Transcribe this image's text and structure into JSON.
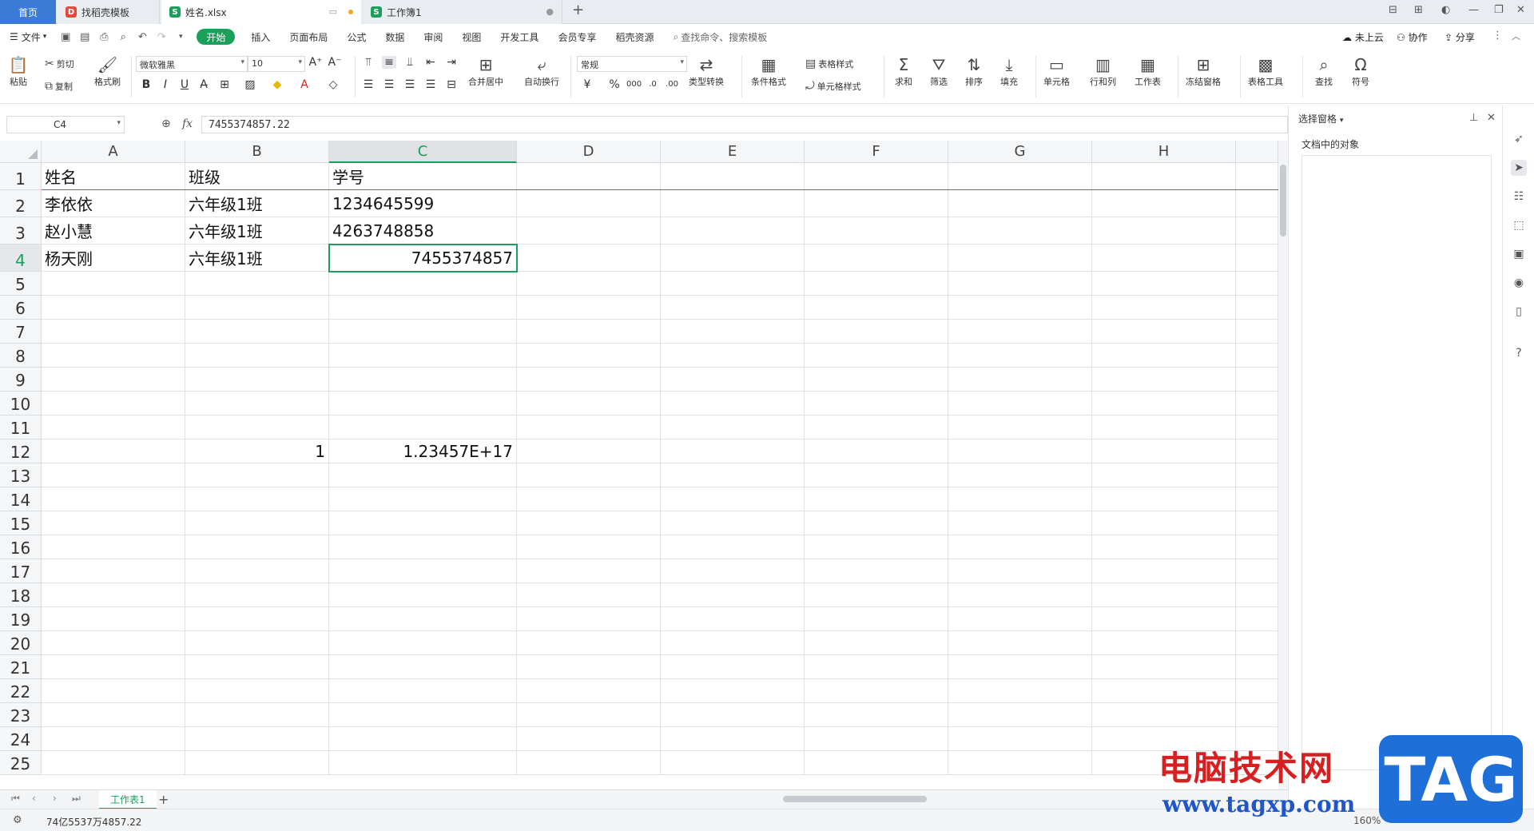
{
  "tabs": {
    "home": "首页",
    "template": "找稻壳模板",
    "file": "姓名.xlsx",
    "workbook": "工作簿1"
  },
  "menu": {
    "file": "文件",
    "items": [
      "开始",
      "插入",
      "页面布局",
      "公式",
      "数据",
      "审阅",
      "视图",
      "开发工具",
      "会员专享",
      "稻壳资源"
    ],
    "search_placeholder": "查找命令、搜索模板",
    "cloud": "未上云",
    "collab": "协作",
    "share": "分享"
  },
  "ribbon": {
    "paste": "粘贴",
    "cut": "剪切",
    "copy": "复制",
    "format_painter": "格式刷",
    "font_name": "微软雅黑",
    "font_size": "10",
    "merge_center": "合并居中",
    "wrap_text": "自动换行",
    "number_format": "常规",
    "type_convert": "类型转换",
    "cond_format": "条件格式",
    "table_style": "表格样式",
    "cell_style": "单元格样式",
    "sum": "求和",
    "filter": "筛选",
    "sort": "排序",
    "fill": "填充",
    "cell": "单元格",
    "row_col": "行和列",
    "worksheet": "工作表",
    "freeze": "冻结窗格",
    "table_tools": "表格工具",
    "find": "查找",
    "symbol": "符号"
  },
  "formula_bar": {
    "name_box": "C4",
    "fx": "fx",
    "value": "7455374857.22"
  },
  "grid": {
    "columns": [
      "A",
      "B",
      "C",
      "D",
      "E",
      "F",
      "G",
      "H"
    ],
    "rows": [
      "1",
      "2",
      "3",
      "4",
      "5",
      "6",
      "7",
      "8",
      "9",
      "10",
      "11",
      "12",
      "13",
      "14",
      "15",
      "16",
      "17",
      "18",
      "19",
      "20",
      "21",
      "22",
      "23",
      "24",
      "25"
    ],
    "cells": {
      "A1": "姓名",
      "B1": "班级",
      "C1": "学号",
      "A2": "李依依",
      "B2": "六年级1班",
      "C2": "1234645599",
      "A3": "赵小慧",
      "B3": "六年级1班",
      "C3": "4263748858",
      "A4": "杨天刚",
      "B4": "六年级1班",
      "C4": "7455374857",
      "B12": "1",
      "C12": "1.23457E+17"
    },
    "selected": "C4"
  },
  "right_pane": {
    "title": "选择窗格",
    "subtitle": "文档中的对象"
  },
  "sheets": {
    "active": "工作表1"
  },
  "status": {
    "text": "74亿5537万4857.22",
    "zoom": "160%"
  },
  "watermark": {
    "site": "电脑技术网",
    "url": "www.tagxp.com",
    "logo": "TAG"
  },
  "colors": {
    "accent": "#1aa05b",
    "home_tab": "#3b7bd8"
  }
}
